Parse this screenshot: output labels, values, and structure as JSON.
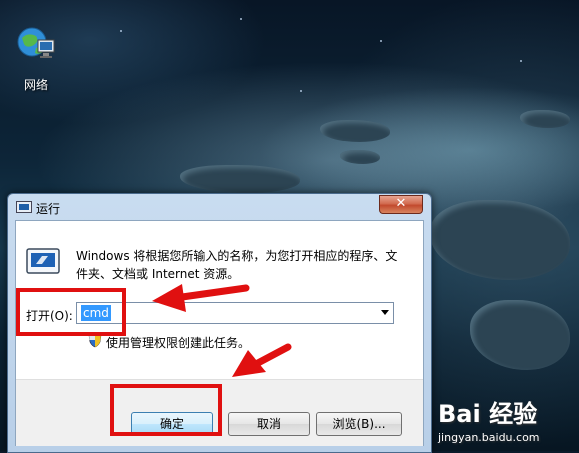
{
  "desktop": {
    "icons": [
      {
        "label": "网络",
        "icon": "network-globe-icon"
      }
    ]
  },
  "dialog": {
    "title": "运行",
    "close_glyph": "✕",
    "description": "Windows 将根据您所输入的名称，为您打开相应的程序、文件夹、文档或 Internet 资源。",
    "open_label": "打开(O):",
    "open_value": "cmd",
    "admin_notice": "使用管理权限创建此任务。",
    "buttons": {
      "ok": "确定",
      "cancel": "取消",
      "browse": "浏览(B)..."
    }
  },
  "annotation_color": "#e01010",
  "watermark": {
    "logo": "Bai 经验",
    "url": "jingyan.baidu.com"
  }
}
